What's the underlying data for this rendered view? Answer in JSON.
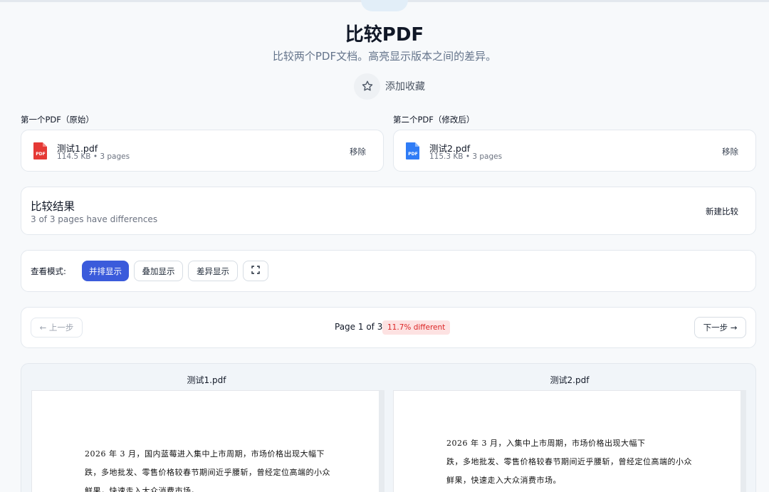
{
  "page": {
    "title": "比较PDF",
    "subtitle": "比较两个PDF文档。高亮显示版本之间的差异。",
    "favorite_label": "添加收藏"
  },
  "files": {
    "first": {
      "section_label": "第一个PDF（原始）",
      "name": "测试1.pdf",
      "meta": "114.5 KB • 3 pages",
      "remove_label": "移除",
      "icon": "pdf-file-red-icon",
      "color": "#e53935"
    },
    "second": {
      "section_label": "第二个PDF（修改后）",
      "name": "测试2.pdf",
      "meta": "115.3 KB • 3 pages",
      "remove_label": "移除",
      "icon": "pdf-file-blue-icon",
      "color": "#2f7cf6"
    }
  },
  "result": {
    "title": "比较结果",
    "summary": "3 of 3 pages have differences",
    "new_compare_label": "新建比较"
  },
  "view_mode": {
    "label": "查看模式:",
    "options": [
      "并排显示",
      "叠加显示",
      "差异显示"
    ],
    "selected": "并排显示",
    "fullscreen_icon": "fullscreen-icon"
  },
  "pager": {
    "prev_label": "← 上一步",
    "next_label": "下一步 →",
    "page_info": "Page 1 of 3",
    "diff_badge": "11.7% different"
  },
  "viewer": {
    "left": {
      "name": "测试1.pdf",
      "lines": [
        "2026  年  3  月，国内蓝莓进入集中上市周期，市场价格出现大幅下",
        "跌，多地批发、零售价格较春节期间近乎腰斩，曾经定位高端的小众",
        "鲜果，快速走入大众消费市场。"
      ]
    },
    "right": {
      "name": "测试2.pdf",
      "lines": [
        "2026  年  3  月，入集中上市周期，市场价格出现大幅下",
        "跌，多地批发、零售价格较春节期间近乎腰斩，曾经定位高端的小众",
        "鲜果，快速走入大众消费市场。"
      ]
    }
  },
  "colors": {
    "accent": "#3b5bdb",
    "diff_badge_bg": "#fde2e2",
    "diff_badge_text": "#dc2626"
  }
}
